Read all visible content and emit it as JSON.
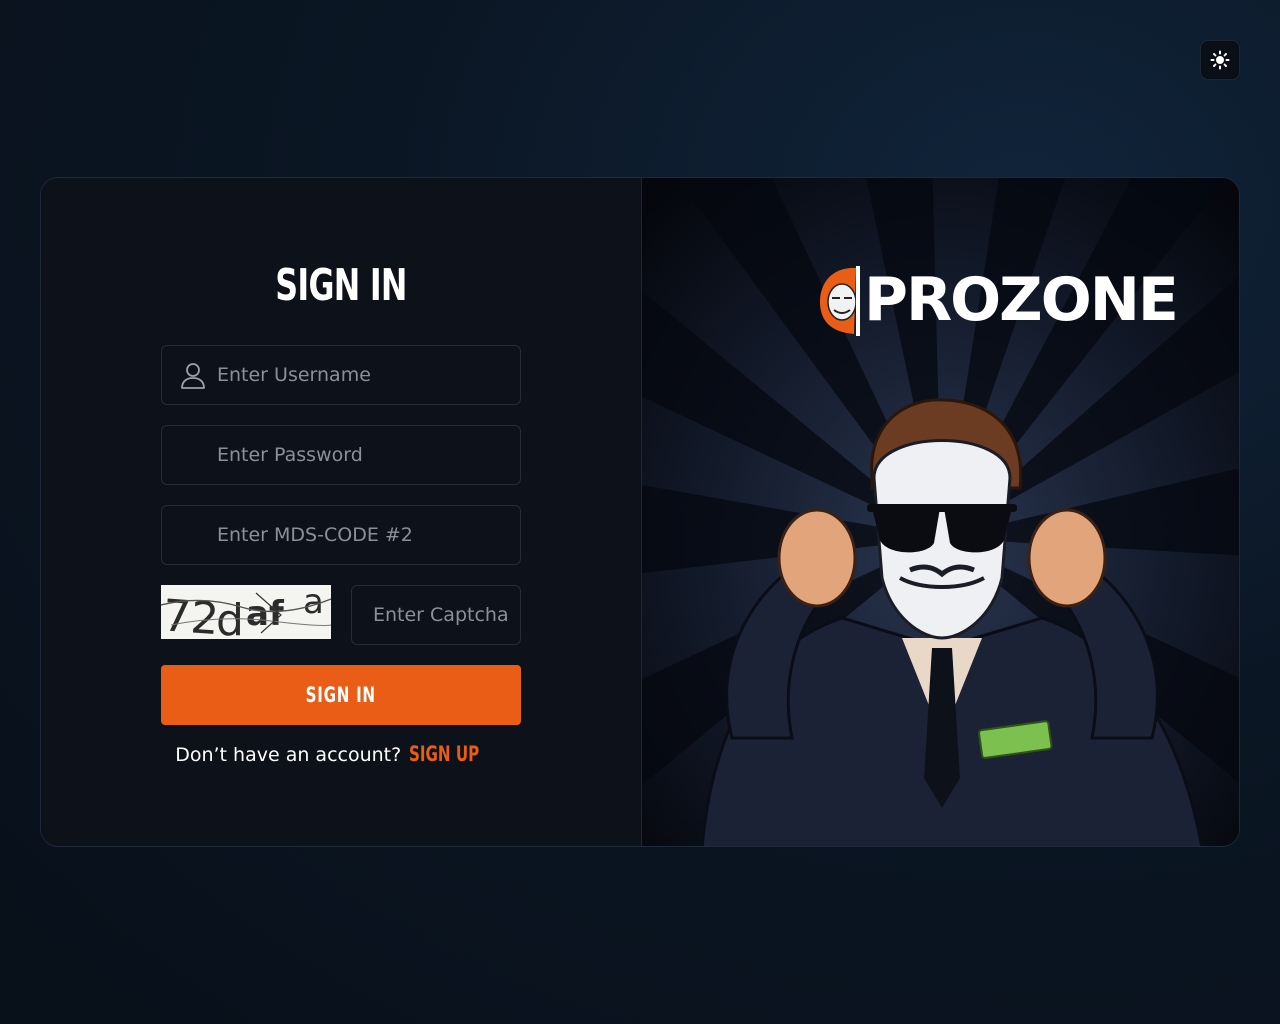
{
  "theme_toggle": {
    "icon": "sun-icon",
    "label": ""
  },
  "signin": {
    "title": "SIGN IN",
    "username_placeholder": "Enter Username",
    "password_placeholder": "Enter Password",
    "mds_placeholder": "Enter MDS-CODE #2",
    "captcha_image_text": "72daf",
    "captcha_placeholder": "Enter Captcha",
    "submit_label": "SIGN IN",
    "signup_prompt": "Don’t have an account?",
    "signup_link": "SIGN UP"
  },
  "brand": {
    "name": "PROZONE"
  },
  "colors": {
    "accent": "#e95d16",
    "background": "#0b1624",
    "card": "#0d111a"
  }
}
